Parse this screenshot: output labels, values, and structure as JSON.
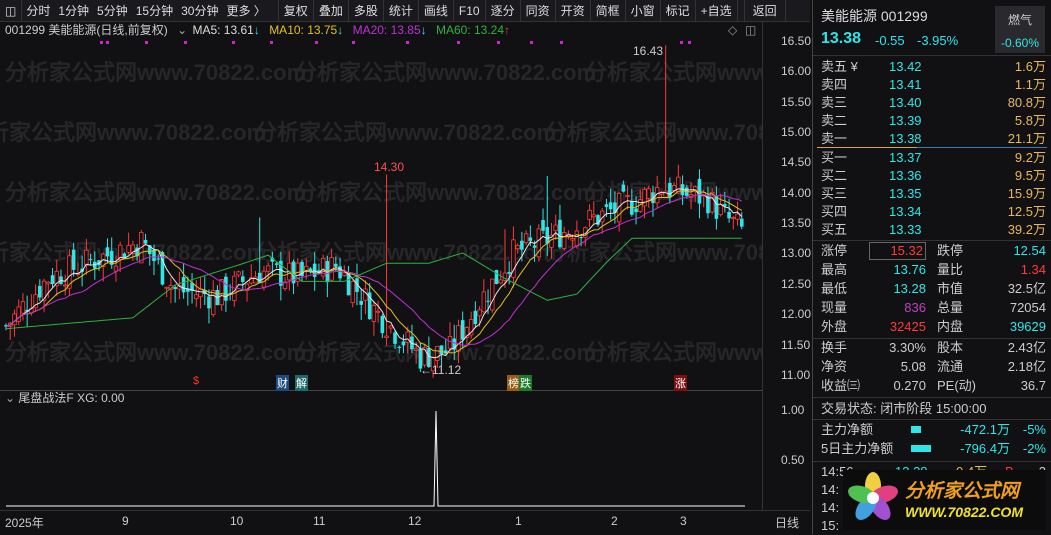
{
  "toolbar": {
    "items": [
      "分时",
      "1分钟",
      "5分钟",
      "15分钟",
      "30分钟",
      "更多 〉"
    ],
    "buttons": [
      "复权",
      "叠加",
      "多股",
      "统计",
      "画线",
      "F10",
      "逐分",
      "同资",
      "开资",
      "简框",
      "小窗",
      "标记",
      "+自选",
      "返回"
    ]
  },
  "info": {
    "title": "001299 美能能源(日线,前复权)",
    "ma5": "MA5: 13.61",
    "ma10": "MA10: 13.75",
    "ma20": "MA20: 13.85",
    "ma60": "MA60: 13.24",
    "ma5_arrow": "↓",
    "ma10_arrow": "↓",
    "ma20_arrow": "↓",
    "ma60_arrow": "↑"
  },
  "price_axis": [
    "16.50",
    "16.00",
    "15.50",
    "15.00",
    "14.50",
    "14.00",
    "13.50",
    "13.00",
    "12.50",
    "12.00",
    "11.50",
    "11.00"
  ],
  "annotations": {
    "high1": "14.30",
    "high2": "16.43",
    "low": "←11.12"
  },
  "event_marks": [
    {
      "t": "$",
      "c": "#d02020"
    },
    {
      "t": "财",
      "c": "#1c4a7a"
    },
    {
      "t": "解",
      "c": "#1c6a6a"
    },
    {
      "t": "榜",
      "c": "#9a5a10"
    },
    {
      "t": "跌",
      "c": "#1a7a2a"
    },
    {
      "t": "涨",
      "c": "#7a1010"
    }
  ],
  "indicator": {
    "label": "尾盘战法F",
    "xg": "XG: 0.00",
    "axis": [
      "1.00",
      "0.50"
    ]
  },
  "dates": {
    "year": "2025年",
    "months": [
      "9",
      "10",
      "11",
      "12",
      "1",
      "2",
      "3"
    ],
    "period": "日线"
  },
  "price_trend": [
    [
      0,
      11.8
    ],
    [
      10,
      12.6
    ],
    [
      25,
      13.0
    ],
    [
      32,
      13.2
    ],
    [
      40,
      12.4
    ],
    [
      50,
      12.3
    ],
    [
      60,
      12.7
    ],
    [
      70,
      12.6
    ],
    [
      78,
      12.8
    ],
    [
      88,
      12.0
    ],
    [
      98,
      11.3
    ],
    [
      105,
      11.4
    ],
    [
      112,
      12.2
    ],
    [
      120,
      13.0
    ],
    [
      130,
      13.3
    ],
    [
      140,
      13.6
    ],
    [
      150,
      13.9
    ],
    [
      155,
      14.1
    ],
    [
      160,
      14.0
    ],
    [
      166,
      13.9
    ],
    [
      170,
      13.6
    ],
    [
      174,
      13.38
    ]
  ],
  "quote": {
    "name": "美能能源",
    "code": "001299",
    "price": "13.38",
    "change": "-0.55",
    "pct": "-3.95%",
    "sector": "燃气",
    "sector_pct": "-0.60%"
  },
  "asks": [
    {
      "l": "卖五 ¥",
      "p": "13.42",
      "v": "1.6万"
    },
    {
      "l": "卖四",
      "p": "13.41",
      "v": "1.1万"
    },
    {
      "l": "卖三",
      "p": "13.40",
      "v": "80.8万"
    },
    {
      "l": "卖二",
      "p": "13.39",
      "v": "5.8万"
    },
    {
      "l": "卖一",
      "p": "13.38",
      "v": "21.1万"
    }
  ],
  "bids": [
    {
      "l": "买一",
      "p": "13.37",
      "v": "9.2万"
    },
    {
      "l": "买二",
      "p": "13.36",
      "v": "9.5万"
    },
    {
      "l": "买三",
      "p": "13.35",
      "v": "15.9万"
    },
    {
      "l": "买四",
      "p": "13.34",
      "v": "12.5万"
    },
    {
      "l": "买五",
      "p": "13.33",
      "v": "39.2万"
    }
  ],
  "stats": [
    [
      {
        "l": "涨停",
        "v": "15.32",
        "c": "red"
      },
      {
        "l": "跌停",
        "v": "12.54",
        "c": "cyan"
      }
    ],
    [
      {
        "l": "最高",
        "v": "13.76",
        "c": "cyan"
      },
      {
        "l": "量比",
        "v": "1.34",
        "c": "red"
      }
    ],
    [
      {
        "l": "最低",
        "v": "13.28",
        "c": "cyan"
      },
      {
        "l": "市值",
        "v": "32.5亿",
        "c": "wh"
      }
    ],
    [
      {
        "l": "现量",
        "v": "836",
        "c": "pur"
      },
      {
        "l": "总量",
        "v": "72054",
        "c": "wh"
      }
    ],
    [
      {
        "l": "外盘",
        "v": "32425",
        "c": "red"
      },
      {
        "l": "内盘",
        "v": "39629",
        "c": "cyan"
      }
    ]
  ],
  "stats2": [
    [
      {
        "l": "换手",
        "v": "3.30%"
      },
      {
        "l": "股本",
        "v": "2.43亿"
      }
    ],
    [
      {
        "l": "净资",
        "v": "5.08"
      },
      {
        "l": "流通",
        "v": "2.18亿"
      }
    ],
    [
      {
        "l": "收益㈢",
        "v": "0.270"
      },
      {
        "l": "PE(动)",
        "v": "36.7"
      }
    ]
  ],
  "trade_status": "交易状态: 闭市阶段 15:00:00",
  "flows": [
    {
      "l": "主力净额",
      "v": "-472.1万",
      "p": "-5%",
      "bar": 0.5
    },
    {
      "l": "5日主力净额",
      "v": "-796.4万",
      "p": "-2%",
      "bar": 1
    }
  ],
  "ticks": [
    {
      "t": "14:56",
      "p": "13.38",
      "v": "0.4万",
      "s": "B",
      "n": "2"
    },
    {
      "t": "14:",
      "p": "",
      "v": "",
      "s": "",
      "n": ""
    },
    {
      "t": "14:",
      "p": "",
      "v": "",
      "s": "",
      "n": ""
    },
    {
      "t": "15:",
      "p": "",
      "v": "",
      "s": "",
      "n": ""
    }
  ],
  "logo": {
    "name": "分析家公式网",
    "url": "WWW.70822.COM"
  }
}
